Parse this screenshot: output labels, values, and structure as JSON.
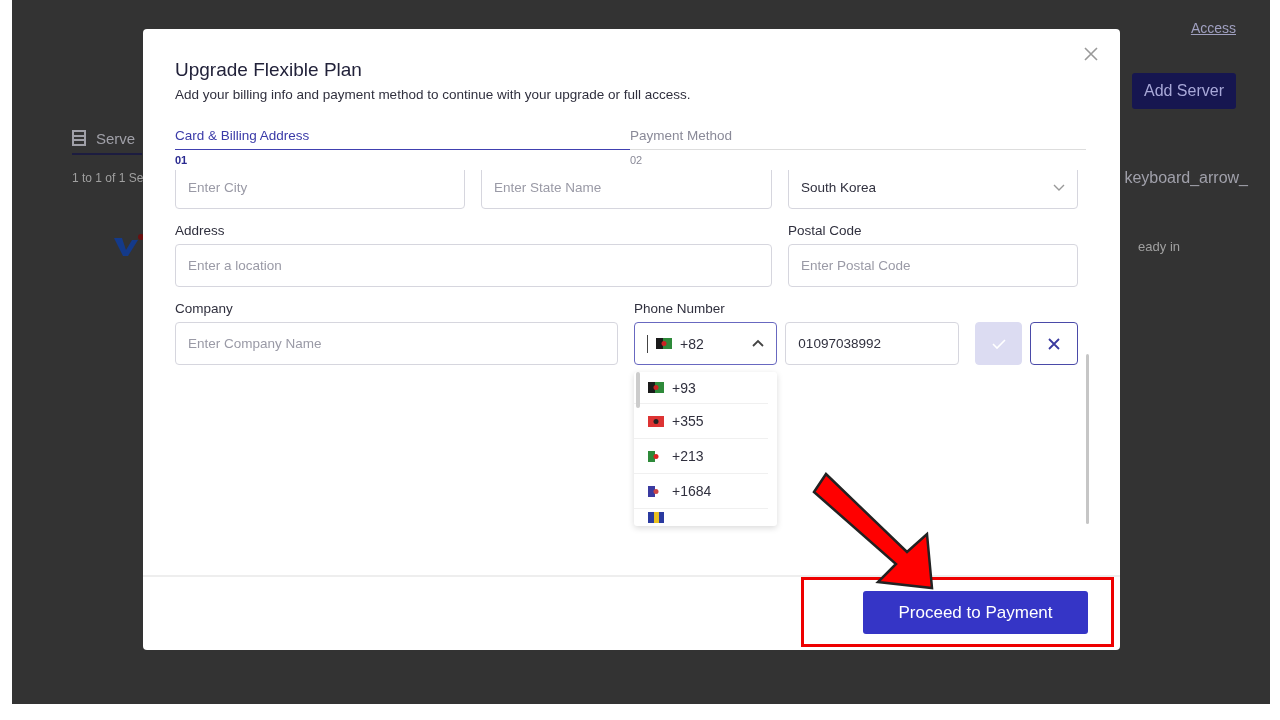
{
  "backdrop": {
    "link": "Access",
    "add_button": "Add Server",
    "tab": "Serve",
    "count": "1 to 1 of 1 Se",
    "icon_text": "keyboard_arrow_",
    "status": "eady in"
  },
  "modal": {
    "title": "Upgrade Flexible Plan",
    "subtitle": "Add your billing info and payment method to continue with your upgrade or full access.",
    "steps": [
      {
        "label": "Card & Billing Address",
        "number": "01",
        "selected": true
      },
      {
        "label": "Payment Method",
        "number": "02",
        "selected": false
      }
    ],
    "city": {
      "placeholder": "Enter City"
    },
    "state": {
      "placeholder": "Enter State Name"
    },
    "country": {
      "value": "South Korea"
    },
    "address": {
      "label": "Address",
      "placeholder": "Enter a location"
    },
    "postal_code": {
      "label": "Postal Code",
      "placeholder": "Enter Postal Code"
    },
    "company": {
      "label": "Company",
      "placeholder": "Enter Company Name"
    },
    "phone": {
      "label": "Phone Number",
      "code": "+82",
      "expanded": true,
      "number": "01097038992",
      "confirm_disabled": true,
      "options": [
        {
          "code": "+93"
        },
        {
          "code": "+355"
        },
        {
          "code": "+213"
        },
        {
          "code": "+1684"
        }
      ]
    },
    "submit": "Proceed to Payment"
  }
}
